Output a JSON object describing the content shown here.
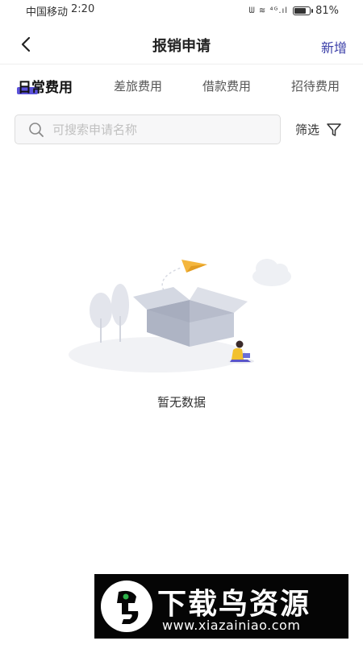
{
  "status_bar": {
    "carrier": "中国移动",
    "time": "2:20",
    "signal_icons": "ᗯ ≋ ⁴ᴳ.ıl",
    "battery_percent": "81%",
    "battery_level": 0.81
  },
  "nav": {
    "title": "报销申请",
    "action_label": "新增"
  },
  "tabs": [
    {
      "label": "日常费用",
      "active": true
    },
    {
      "label": "差旅费用",
      "active": false
    },
    {
      "label": "借款费用",
      "active": false
    },
    {
      "label": "招待费用",
      "active": false
    }
  ],
  "search": {
    "placeholder": "可搜索申请名称",
    "value": ""
  },
  "filter": {
    "label": "筛选"
  },
  "empty_state": {
    "text": "暂无数据"
  },
  "watermark": {
    "title": "下载鸟资源",
    "url": "www.xiazainiao.com"
  },
  "colors": {
    "accent": "#3b3fa8",
    "tab_indicator": "#4a3fd6",
    "plane": "#f4b63d",
    "box": "#b9bfce"
  },
  "icons": {
    "back": "chevron-left-icon",
    "search": "search-icon",
    "filter": "filter-funnel-icon"
  }
}
